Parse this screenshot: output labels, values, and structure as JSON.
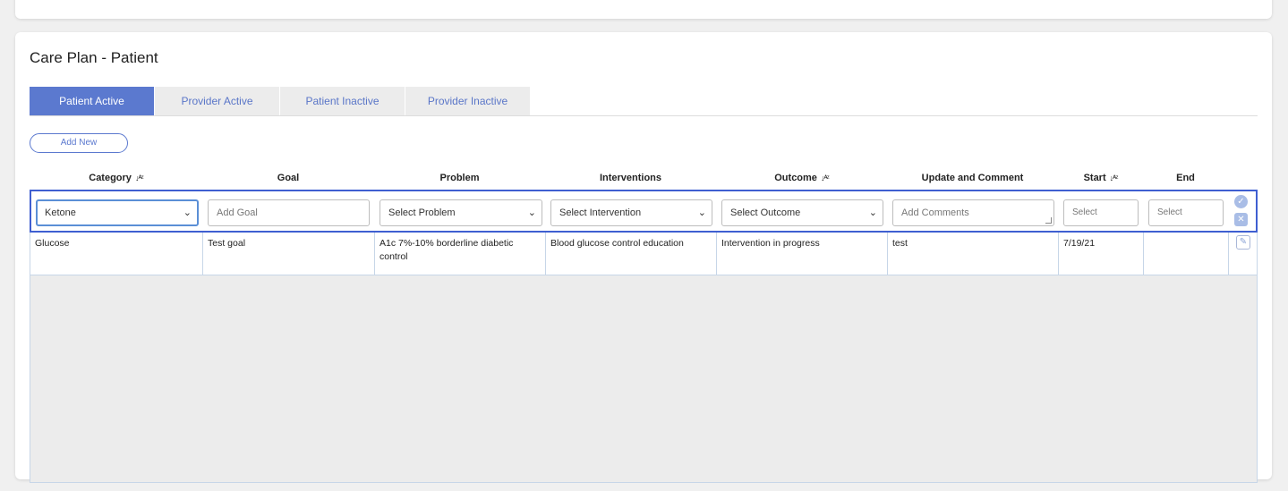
{
  "card_title": "Care Plan - Patient",
  "tabs": [
    {
      "label": "Patient Active",
      "active": true
    },
    {
      "label": "Provider Active",
      "active": false
    },
    {
      "label": "Patient Inactive",
      "active": false
    },
    {
      "label": "Provider Inactive",
      "active": false
    }
  ],
  "add_new_label": "Add New",
  "columns": {
    "category": "Category",
    "goal": "Goal",
    "problem": "Problem",
    "interventions": "Interventions",
    "outcome": "Outcome",
    "update_comment": "Update and Comment",
    "start": "Start",
    "end": "End"
  },
  "sort_icon": "↓ᴬᶻ",
  "edit_row": {
    "category_value": "Ketone",
    "goal_placeholder": "Add Goal",
    "problem_value": "Select Problem",
    "intervention_value": "Select Intervention",
    "outcome_value": "Select Outcome",
    "comments_placeholder": "Add Comments",
    "start_placeholder": "Select",
    "end_placeholder": "Select"
  },
  "rows": [
    {
      "category": "Glucose",
      "goal": "Test goal",
      "problem": "A1c 7%-10% borderline diabetic control",
      "interventions": "Blood glucose control education",
      "outcome": "Intervention in progress",
      "comment": "test",
      "start": "7/19/21",
      "end": ""
    }
  ],
  "colors": {
    "accent": "#5b79cf",
    "edit_border": "#3f5fd1",
    "tab_inactive_bg": "#ececec"
  }
}
